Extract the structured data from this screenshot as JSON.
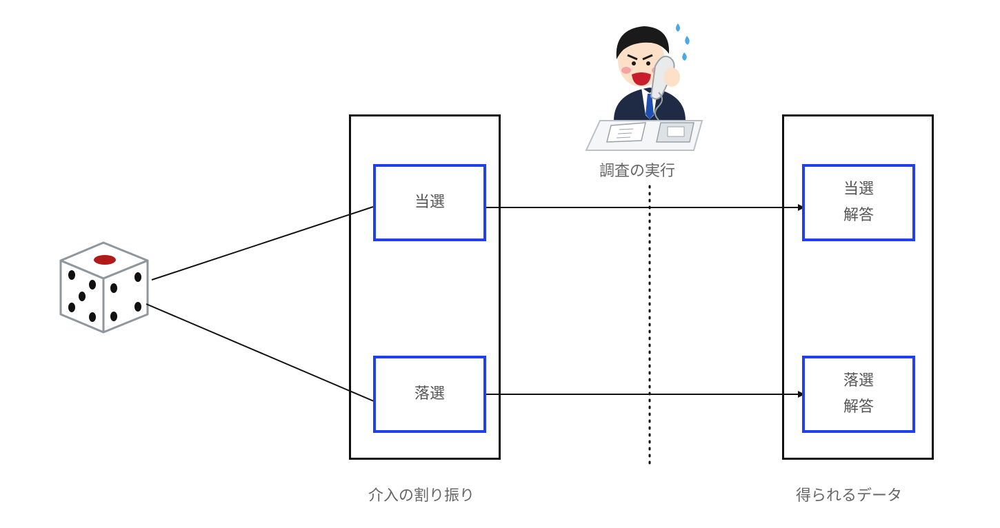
{
  "labels": {
    "survey": "調査の実行",
    "assignment": "介入の割り振り",
    "obtained": "得られるデータ"
  },
  "assignment_boxes": {
    "win": "当選",
    "lose": "落選"
  },
  "result_boxes": {
    "win_line1": "当選",
    "win_line2": "解答",
    "lose_line1": "落選",
    "lose_line2": "解答"
  },
  "colors": {
    "inner_border": "#1f3ff0",
    "outer_border": "#111111",
    "dice_pip_one": "#b01a1a"
  },
  "icons": {
    "dice": "dice-icon",
    "person": "businessman-on-phone-icon"
  }
}
